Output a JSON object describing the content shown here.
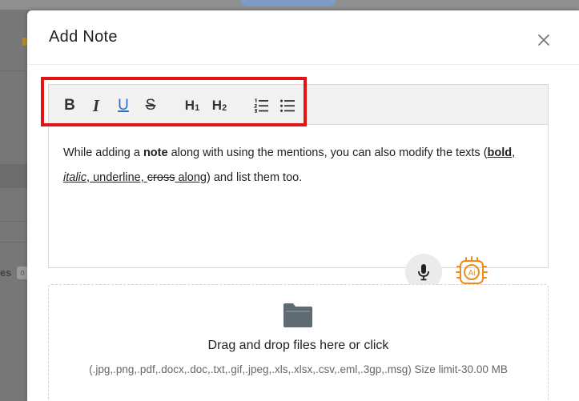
{
  "modal": {
    "title": "Add Note"
  },
  "toolbar": {
    "bold": "B",
    "italic": "I",
    "underline": "U",
    "strike": "S",
    "h1": "H",
    "h1_sub": "1",
    "h2": "H",
    "h2_sub": "2"
  },
  "note": {
    "t1": "While adding a ",
    "t2": "note",
    "t3": " along with using the mentions, you can also modify the texts (",
    "t4": "bold",
    "t5": ", ",
    "t6": "italic",
    "t7": ", underline, ",
    "t8": "cross",
    "t9": " along",
    "t10": ") and list them too."
  },
  "dropzone": {
    "title": "Drag and drop files here or click",
    "hint": "(.jpg,.png,.pdf,.docx,.doc,.txt,.gif,.jpeg,.xls,.xlsx,.csv,.eml,.3gp,.msg) Size limit-30.00 MB"
  },
  "background": {
    "label": "es",
    "badge": "0"
  },
  "colors": {
    "highlight": "#e21313",
    "accent": "#2b6fc8",
    "ai_orange": "#f08a1c"
  },
  "icons": [
    "close-icon",
    "bold-icon",
    "italic-icon",
    "underline-icon",
    "strikethrough-icon",
    "heading-1-icon",
    "heading-2-icon",
    "ordered-list-icon",
    "bullet-list-icon",
    "microphone-icon",
    "ai-chip-icon",
    "folder-icon"
  ]
}
